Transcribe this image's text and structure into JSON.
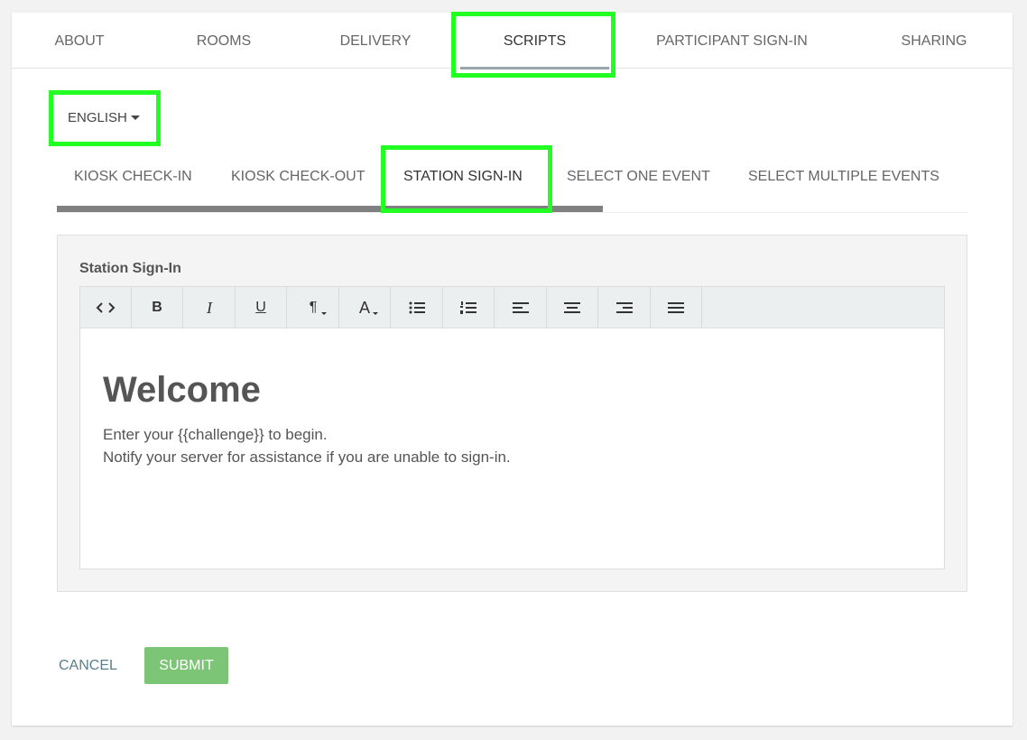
{
  "top_tabs": [
    {
      "label": "ABOUT"
    },
    {
      "label": "ROOMS"
    },
    {
      "label": "DELIVERY"
    },
    {
      "label": "SCRIPTS"
    },
    {
      "label": "PARTICIPANT SIGN-IN"
    },
    {
      "label": "SHARING"
    }
  ],
  "language": {
    "selected": "ENGLISH"
  },
  "sub_tabs": [
    {
      "label": "KIOSK CHECK-IN"
    },
    {
      "label": "KIOSK CHECK-OUT"
    },
    {
      "label": "STATION SIGN-IN"
    },
    {
      "label": "SELECT ONE EVENT"
    },
    {
      "label": "SELECT MULTIPLE EVENTS"
    }
  ],
  "editor": {
    "title": "Station Sign-In",
    "toolbar": {
      "code": "<>",
      "bold": "B",
      "italic": "I",
      "underline": "U",
      "paragraph": "¶",
      "font_color": "A"
    },
    "heading": "Welcome",
    "lines": [
      "Enter your {{challenge}} to begin.",
      "Notify your server for assistance if you are unable to sign-in."
    ]
  },
  "actions": {
    "cancel_label": "CANCEL",
    "submit_label": "SUBMIT"
  },
  "colors": {
    "highlight": "#22ff22",
    "submit_bg": "#7cc576",
    "cancel_text": "#5a7e8c"
  }
}
